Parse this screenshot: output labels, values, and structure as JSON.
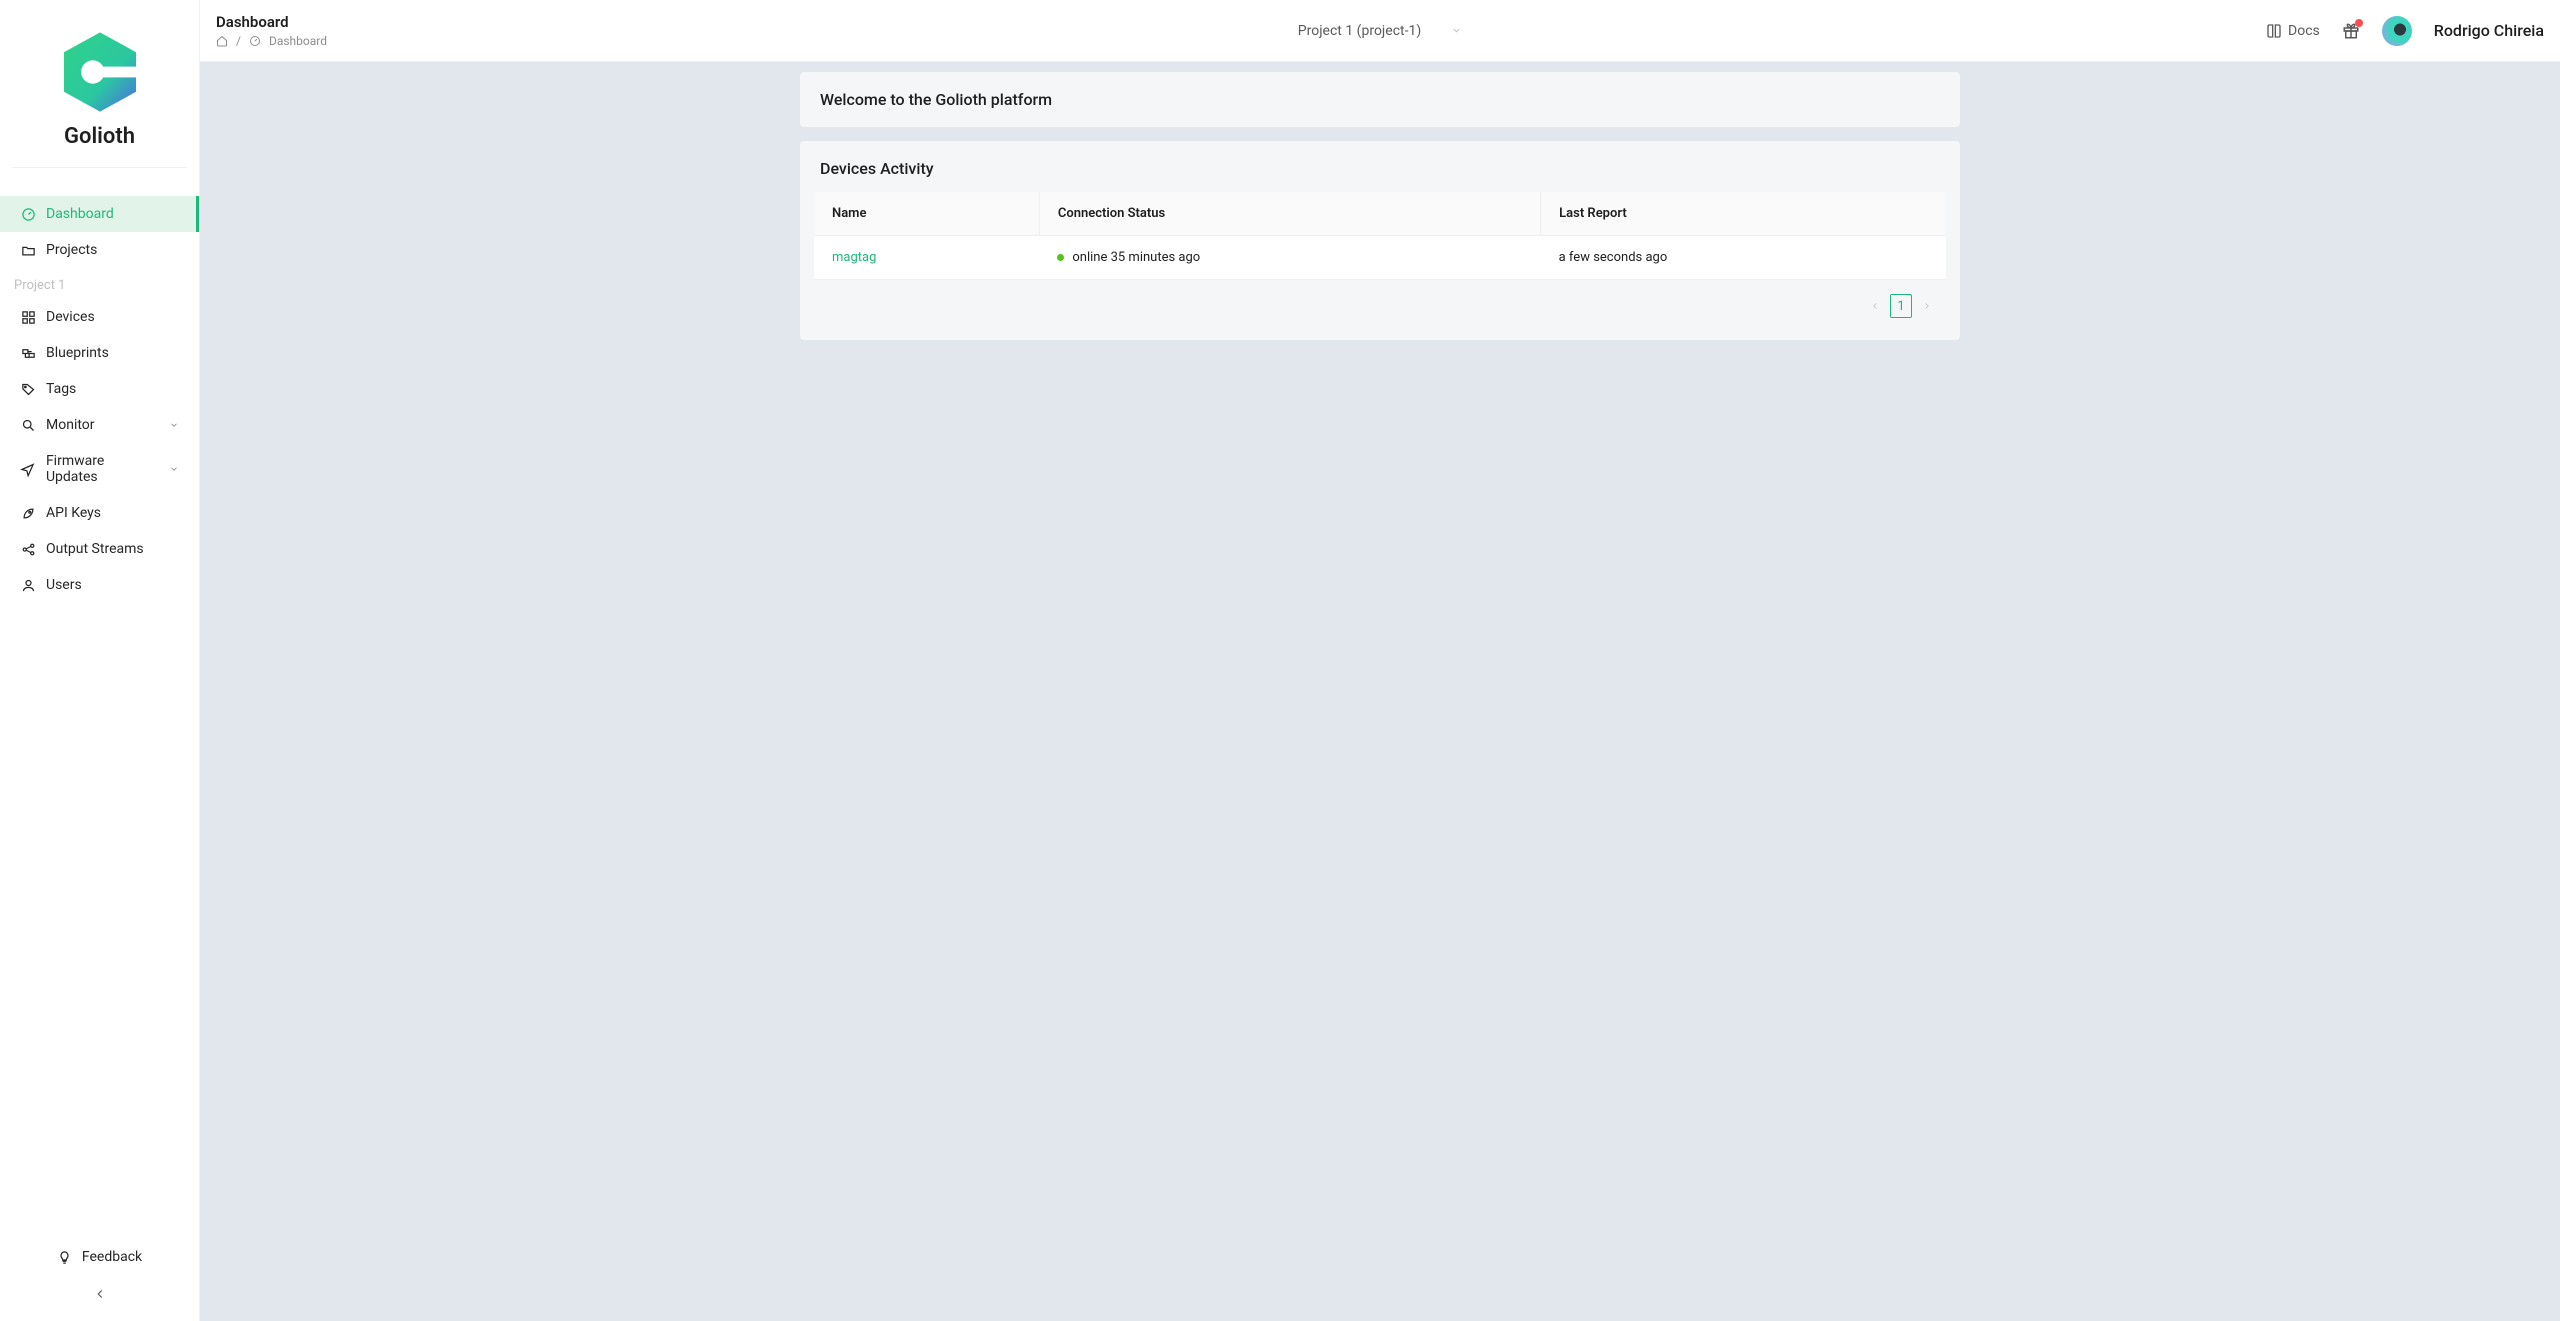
{
  "brand": {
    "name": "Golioth"
  },
  "sidebar": {
    "items": [
      {
        "label": "Dashboard",
        "icon": "dashboard-icon",
        "active": true
      },
      {
        "label": "Projects",
        "icon": "folder-icon"
      }
    ],
    "project_section_label": "Project 1",
    "project_items": [
      {
        "label": "Devices",
        "icon": "grid-icon"
      },
      {
        "label": "Blueprints",
        "icon": "blueprint-icon"
      },
      {
        "label": "Tags",
        "icon": "tag-icon"
      },
      {
        "label": "Monitor",
        "icon": "search-icon",
        "has_children": true
      },
      {
        "label": "Firmware Updates",
        "icon": "send-icon",
        "has_children": true
      },
      {
        "label": "API Keys",
        "icon": "rocket-icon"
      },
      {
        "label": "Output Streams",
        "icon": "share-icon"
      },
      {
        "label": "Users",
        "icon": "user-icon"
      }
    ],
    "feedback_label": "Feedback"
  },
  "header": {
    "page_title": "Dashboard",
    "breadcrumb_current": "Dashboard",
    "project_selector": "Project 1 (project-1)",
    "docs_label": "Docs",
    "user_name": "Rodrigo Chireia"
  },
  "welcome": {
    "title": "Welcome to the Golioth platform"
  },
  "activity": {
    "title": "Devices Activity",
    "columns": {
      "name": "Name",
      "conn": "Connection Status",
      "last": "Last Report"
    },
    "rows": [
      {
        "name": "magtag",
        "status_text": "online 35 minutes ago",
        "last_report": "a few seconds ago"
      }
    ],
    "pagination": {
      "page": "1"
    }
  }
}
